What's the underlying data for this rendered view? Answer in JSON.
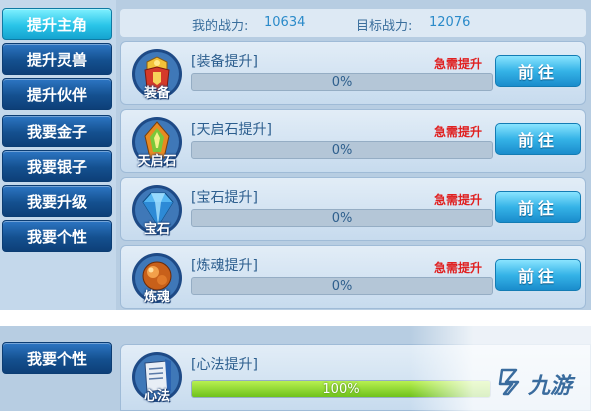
{
  "top_menu": {
    "items": [
      {
        "label": "提升主角",
        "active": true
      },
      {
        "label": "提升灵兽",
        "active": false
      },
      {
        "label": "提升伙伴",
        "active": false
      },
      {
        "label": "我要金子",
        "active": false
      },
      {
        "label": "我要银子",
        "active": false
      },
      {
        "label": "我要升级",
        "active": false
      },
      {
        "label": "我要个性",
        "active": false
      }
    ]
  },
  "power": {
    "my_label": "我的战力:",
    "my_value": "10634",
    "target_label": "目标战力:",
    "target_value": "12076"
  },
  "quests": [
    {
      "title": "[装备提升]",
      "icon_label": "装备",
      "icon": "armor-icon",
      "urgent": "急需提升",
      "progress_text": "0%",
      "progress": 0,
      "button": "前往"
    },
    {
      "title": "[天启石提升]",
      "icon_label": "天启石",
      "icon": "tianqi-stone-icon",
      "urgent": "急需提升",
      "progress_text": "0%",
      "progress": 0,
      "button": "前往"
    },
    {
      "title": "[宝石提升]",
      "icon_label": "宝石",
      "icon": "gem-icon",
      "urgent": "急需提升",
      "progress_text": "0%",
      "progress": 0,
      "button": "前往"
    },
    {
      "title": "[炼魂提升]",
      "icon_label": "炼魂",
      "icon": "soul-refine-icon",
      "urgent": "急需提升",
      "progress_text": "0%",
      "progress": 0,
      "button": "前往"
    }
  ],
  "bottom": {
    "menu_label": "我要个性",
    "quest": {
      "title": "[心法提升]",
      "icon_label": "心法",
      "icon": "scroll-icon",
      "progress_text": "100%",
      "progress": 1
    }
  },
  "watermark": {
    "text": "九游"
  },
  "colors": {
    "urgent": "#e02020",
    "menu_blue": "#14508f",
    "menu_active": "#29c4e8",
    "button_cyan": "#35b3e7",
    "progress_green": "#8bd93a"
  }
}
